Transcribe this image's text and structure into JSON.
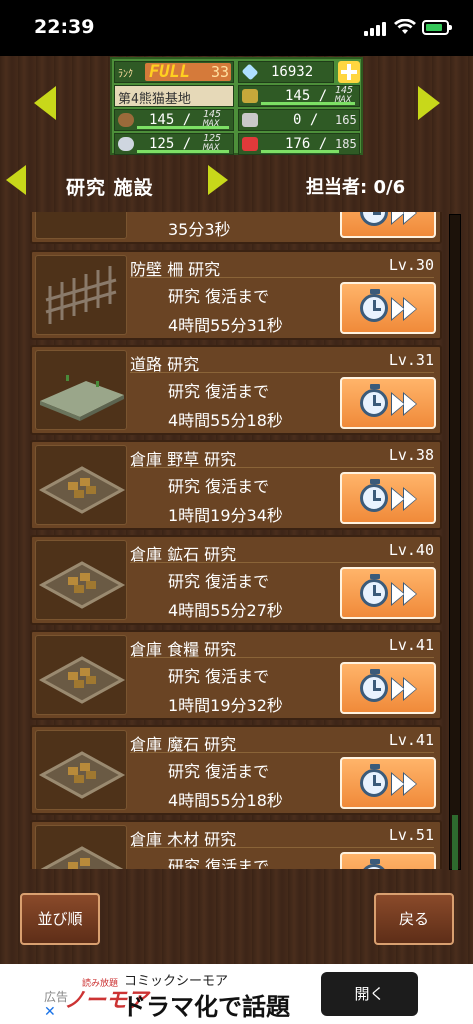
{
  "status_bar": {
    "time": "22:39"
  },
  "resources": {
    "rank_label": "ﾗﾝｸ",
    "rank_status": "FULL",
    "rank_value": "33",
    "gems": "16932",
    "base_name": "第4熊猫基地",
    "population": "145 /",
    "population_max": "145",
    "population_max_tag": "MAX",
    "wood": "145 /",
    "wood_max": "145",
    "wood_max_tag": "MAX",
    "workers": "0 /",
    "workers_max": "165",
    "ore": "125 /",
    "ore_max": "125",
    "ore_max_tag": "MAX",
    "magic_stone": "176 /",
    "magic_stone_max": "185"
  },
  "header": {
    "title": "研究 施設",
    "staff_label": "担当者: 0/6"
  },
  "research_items": [
    {
      "name": "",
      "level": "",
      "status": "",
      "time": "35分3秒"
    },
    {
      "name": "防壁 柵 研究",
      "level": "Lv.30",
      "status": "研究 復活まで",
      "time": "4時間55分31秒"
    },
    {
      "name": "道路 研究",
      "level": "Lv.31",
      "status": "研究 復活まで",
      "time": "4時間55分18秒"
    },
    {
      "name": "倉庫 野草 研究",
      "level": "Lv.38",
      "status": "研究 復活まで",
      "time": "1時間19分34秒"
    },
    {
      "name": "倉庫 鉱石 研究",
      "level": "Lv.40",
      "status": "研究 復活まで",
      "time": "4時間55分27秒"
    },
    {
      "name": "倉庫 食糧 研究",
      "level": "Lv.41",
      "status": "研究 復活まで",
      "time": "1時間19分32秒"
    },
    {
      "name": "倉庫 魔石 研究",
      "level": "Lv.41",
      "status": "研究 復活まで",
      "time": "4時間55分18秒"
    },
    {
      "name": "倉庫 木材 研究",
      "level": "Lv.51",
      "status": "研究 復活まで",
      "time": ""
    }
  ],
  "bottom": {
    "sort_label": "並び順",
    "back_label": "戻る"
  },
  "ad": {
    "ad_label": "広告",
    "brand_small": "読み放題",
    "brand": "ノーモア",
    "subtitle": "コミックシーモア",
    "headline": "ドラマ化で話題",
    "open_label": "開く"
  },
  "colors": {
    "panel_green": "#4d8f3a",
    "accent_yellow": "#c8d81a",
    "button_orange": "#f08a3a",
    "wood_brown": "#6a4424"
  }
}
